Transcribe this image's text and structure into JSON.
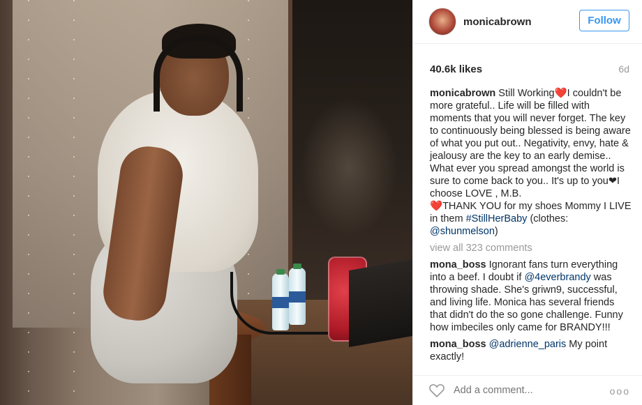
{
  "header": {
    "username": "monicabrown",
    "follow_label": "Follow"
  },
  "stats": {
    "likes": "40.6k likes",
    "age": "6d"
  },
  "caption": {
    "username": "monicabrown",
    "part1": "Still Working",
    "part2": "I couldn't be more grateful.. Life will be filled with moments that you will never forget. The key to continuously being blessed is being aware of what you put out.. Negativity, envy, hate & jealousy are the key to an early demise.. What ever you spread amongst the world is sure to come back to you.. It's up to you",
    "part3": "I choose LOVE  , M.B.",
    "part4": "THANK YOU for my shoes Mommy I LIVE in them ",
    "hashtag": "#StillHerBaby",
    "part5": " (clothes: ",
    "mention": "@shunmelson",
    "part6": ")"
  },
  "view_all": "view all 323 comments",
  "comments": [
    {
      "username": "mona_boss",
      "pre": "Ignorant fans turn everything into a beef. I doubt if ",
      "mention": "@4everbrandy",
      "post": " was throwing shade. She's griwn9, successful, and living life. Monica has several friends that didn't do the so gone challenge. Funny how imbeciles only came for BRANDY!!!"
    },
    {
      "username": "mona_boss",
      "pre": "",
      "mention": "@adrienne_paris",
      "post": " My point exactly!"
    }
  ],
  "add_comment": {
    "placeholder": "Add a comment..."
  },
  "more_label": "ooo",
  "icons": {
    "like": "heart-outline-icon",
    "more": "more-options-icon"
  },
  "colors": {
    "accent": "#3897f0",
    "link": "#003569",
    "muted": "#999999",
    "heart": "#e0243a"
  }
}
